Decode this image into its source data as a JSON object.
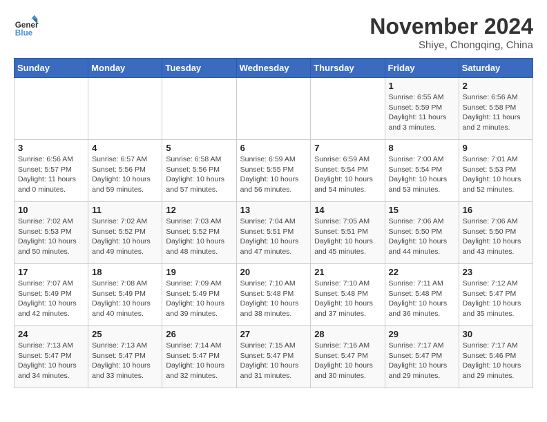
{
  "header": {
    "logo_general": "General",
    "logo_blue": "Blue",
    "month_title": "November 2024",
    "location": "Shiye, Chongqing, China"
  },
  "days_of_week": [
    "Sunday",
    "Monday",
    "Tuesday",
    "Wednesday",
    "Thursday",
    "Friday",
    "Saturday"
  ],
  "weeks": [
    [
      {
        "day": "",
        "sunrise": "",
        "sunset": "",
        "daylight": ""
      },
      {
        "day": "",
        "sunrise": "",
        "sunset": "",
        "daylight": ""
      },
      {
        "day": "",
        "sunrise": "",
        "sunset": "",
        "daylight": ""
      },
      {
        "day": "",
        "sunrise": "",
        "sunset": "",
        "daylight": ""
      },
      {
        "day": "",
        "sunrise": "",
        "sunset": "",
        "daylight": ""
      },
      {
        "day": "1",
        "sunrise": "Sunrise: 6:55 AM",
        "sunset": "Sunset: 5:59 PM",
        "daylight": "Daylight: 11 hours and 3 minutes."
      },
      {
        "day": "2",
        "sunrise": "Sunrise: 6:56 AM",
        "sunset": "Sunset: 5:58 PM",
        "daylight": "Daylight: 11 hours and 2 minutes."
      }
    ],
    [
      {
        "day": "3",
        "sunrise": "Sunrise: 6:56 AM",
        "sunset": "Sunset: 5:57 PM",
        "daylight": "Daylight: 11 hours and 0 minutes."
      },
      {
        "day": "4",
        "sunrise": "Sunrise: 6:57 AM",
        "sunset": "Sunset: 5:56 PM",
        "daylight": "Daylight: 10 hours and 59 minutes."
      },
      {
        "day": "5",
        "sunrise": "Sunrise: 6:58 AM",
        "sunset": "Sunset: 5:56 PM",
        "daylight": "Daylight: 10 hours and 57 minutes."
      },
      {
        "day": "6",
        "sunrise": "Sunrise: 6:59 AM",
        "sunset": "Sunset: 5:55 PM",
        "daylight": "Daylight: 10 hours and 56 minutes."
      },
      {
        "day": "7",
        "sunrise": "Sunrise: 6:59 AM",
        "sunset": "Sunset: 5:54 PM",
        "daylight": "Daylight: 10 hours and 54 minutes."
      },
      {
        "day": "8",
        "sunrise": "Sunrise: 7:00 AM",
        "sunset": "Sunset: 5:54 PM",
        "daylight": "Daylight: 10 hours and 53 minutes."
      },
      {
        "day": "9",
        "sunrise": "Sunrise: 7:01 AM",
        "sunset": "Sunset: 5:53 PM",
        "daylight": "Daylight: 10 hours and 52 minutes."
      }
    ],
    [
      {
        "day": "10",
        "sunrise": "Sunrise: 7:02 AM",
        "sunset": "Sunset: 5:53 PM",
        "daylight": "Daylight: 10 hours and 50 minutes."
      },
      {
        "day": "11",
        "sunrise": "Sunrise: 7:02 AM",
        "sunset": "Sunset: 5:52 PM",
        "daylight": "Daylight: 10 hours and 49 minutes."
      },
      {
        "day": "12",
        "sunrise": "Sunrise: 7:03 AM",
        "sunset": "Sunset: 5:52 PM",
        "daylight": "Daylight: 10 hours and 48 minutes."
      },
      {
        "day": "13",
        "sunrise": "Sunrise: 7:04 AM",
        "sunset": "Sunset: 5:51 PM",
        "daylight": "Daylight: 10 hours and 47 minutes."
      },
      {
        "day": "14",
        "sunrise": "Sunrise: 7:05 AM",
        "sunset": "Sunset: 5:51 PM",
        "daylight": "Daylight: 10 hours and 45 minutes."
      },
      {
        "day": "15",
        "sunrise": "Sunrise: 7:06 AM",
        "sunset": "Sunset: 5:50 PM",
        "daylight": "Daylight: 10 hours and 44 minutes."
      },
      {
        "day": "16",
        "sunrise": "Sunrise: 7:06 AM",
        "sunset": "Sunset: 5:50 PM",
        "daylight": "Daylight: 10 hours and 43 minutes."
      }
    ],
    [
      {
        "day": "17",
        "sunrise": "Sunrise: 7:07 AM",
        "sunset": "Sunset: 5:49 PM",
        "daylight": "Daylight: 10 hours and 42 minutes."
      },
      {
        "day": "18",
        "sunrise": "Sunrise: 7:08 AM",
        "sunset": "Sunset: 5:49 PM",
        "daylight": "Daylight: 10 hours and 40 minutes."
      },
      {
        "day": "19",
        "sunrise": "Sunrise: 7:09 AM",
        "sunset": "Sunset: 5:49 PM",
        "daylight": "Daylight: 10 hours and 39 minutes."
      },
      {
        "day": "20",
        "sunrise": "Sunrise: 7:10 AM",
        "sunset": "Sunset: 5:48 PM",
        "daylight": "Daylight: 10 hours and 38 minutes."
      },
      {
        "day": "21",
        "sunrise": "Sunrise: 7:10 AM",
        "sunset": "Sunset: 5:48 PM",
        "daylight": "Daylight: 10 hours and 37 minutes."
      },
      {
        "day": "22",
        "sunrise": "Sunrise: 7:11 AM",
        "sunset": "Sunset: 5:48 PM",
        "daylight": "Daylight: 10 hours and 36 minutes."
      },
      {
        "day": "23",
        "sunrise": "Sunrise: 7:12 AM",
        "sunset": "Sunset: 5:47 PM",
        "daylight": "Daylight: 10 hours and 35 minutes."
      }
    ],
    [
      {
        "day": "24",
        "sunrise": "Sunrise: 7:13 AM",
        "sunset": "Sunset: 5:47 PM",
        "daylight": "Daylight: 10 hours and 34 minutes."
      },
      {
        "day": "25",
        "sunrise": "Sunrise: 7:13 AM",
        "sunset": "Sunset: 5:47 PM",
        "daylight": "Daylight: 10 hours and 33 minutes."
      },
      {
        "day": "26",
        "sunrise": "Sunrise: 7:14 AM",
        "sunset": "Sunset: 5:47 PM",
        "daylight": "Daylight: 10 hours and 32 minutes."
      },
      {
        "day": "27",
        "sunrise": "Sunrise: 7:15 AM",
        "sunset": "Sunset: 5:47 PM",
        "daylight": "Daylight: 10 hours and 31 minutes."
      },
      {
        "day": "28",
        "sunrise": "Sunrise: 7:16 AM",
        "sunset": "Sunset: 5:47 PM",
        "daylight": "Daylight: 10 hours and 30 minutes."
      },
      {
        "day": "29",
        "sunrise": "Sunrise: 7:17 AM",
        "sunset": "Sunset: 5:47 PM",
        "daylight": "Daylight: 10 hours and 29 minutes."
      },
      {
        "day": "30",
        "sunrise": "Sunrise: 7:17 AM",
        "sunset": "Sunset: 5:46 PM",
        "daylight": "Daylight: 10 hours and 29 minutes."
      }
    ]
  ]
}
